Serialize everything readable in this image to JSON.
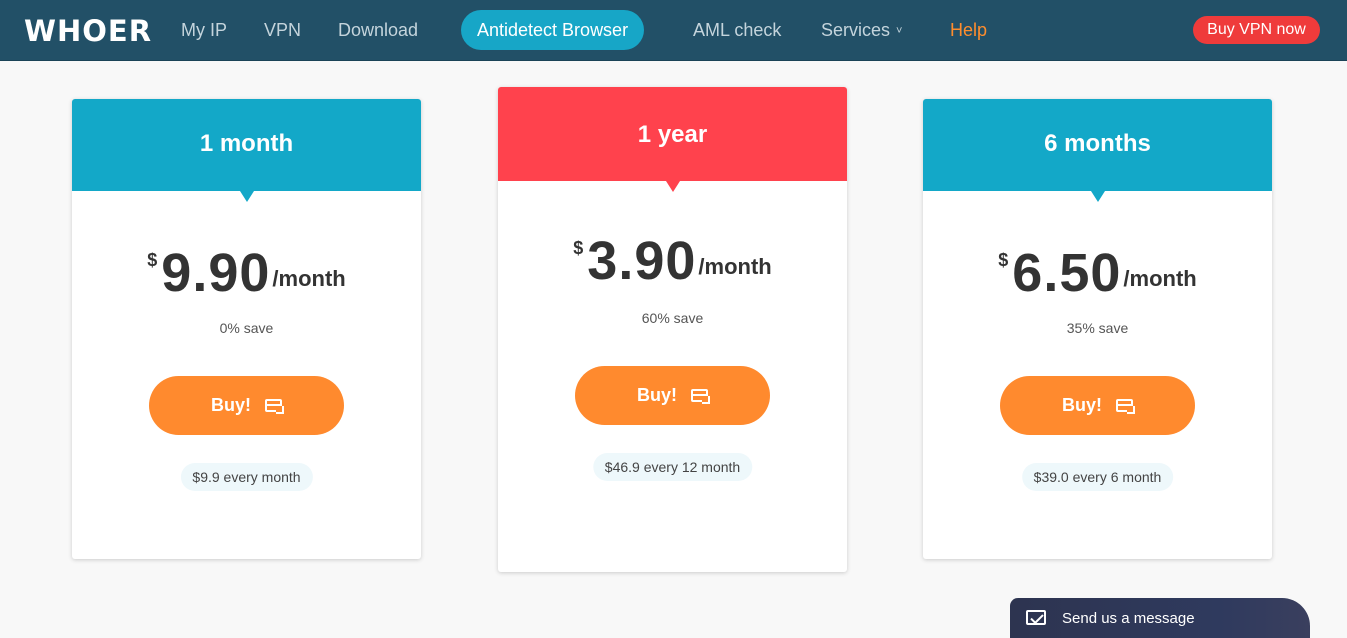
{
  "nav": {
    "logo": "WHOER",
    "items": [
      "My IP",
      "VPN",
      "Download",
      "Antidetect Browser",
      "AML check",
      "Services",
      "Help"
    ],
    "services_chevron": "˅",
    "buy_vpn": "Buy VPN now"
  },
  "plans": [
    {
      "title": "1 month",
      "currency": "$",
      "price": "9.90",
      "per": "/month",
      "save": "0% save",
      "buy_label": "Buy!",
      "total": "$9.9 every month",
      "header_color": "#13a8c8"
    },
    {
      "title": "1 year",
      "currency": "$",
      "price": "3.90",
      "per": "/month",
      "save": "60% save",
      "buy_label": "Buy!",
      "total": "$46.9 every 12 month",
      "header_color": "#ff424d"
    },
    {
      "title": "6 months",
      "currency": "$",
      "price": "6.50",
      "per": "/month",
      "save": "35% save",
      "buy_label": "Buy!",
      "total": "$39.0 every 6 month",
      "header_color": "#13a8c8"
    }
  ],
  "chat": {
    "label": "Send us a message"
  },
  "colors": {
    "navbar": "#225067",
    "accent_blue": "#13a8c8",
    "accent_red": "#ff424d",
    "buy_orange": "#ff8a2e",
    "help_orange": "#ff8d2d",
    "buy_vpn_red": "#ef3b3b"
  }
}
